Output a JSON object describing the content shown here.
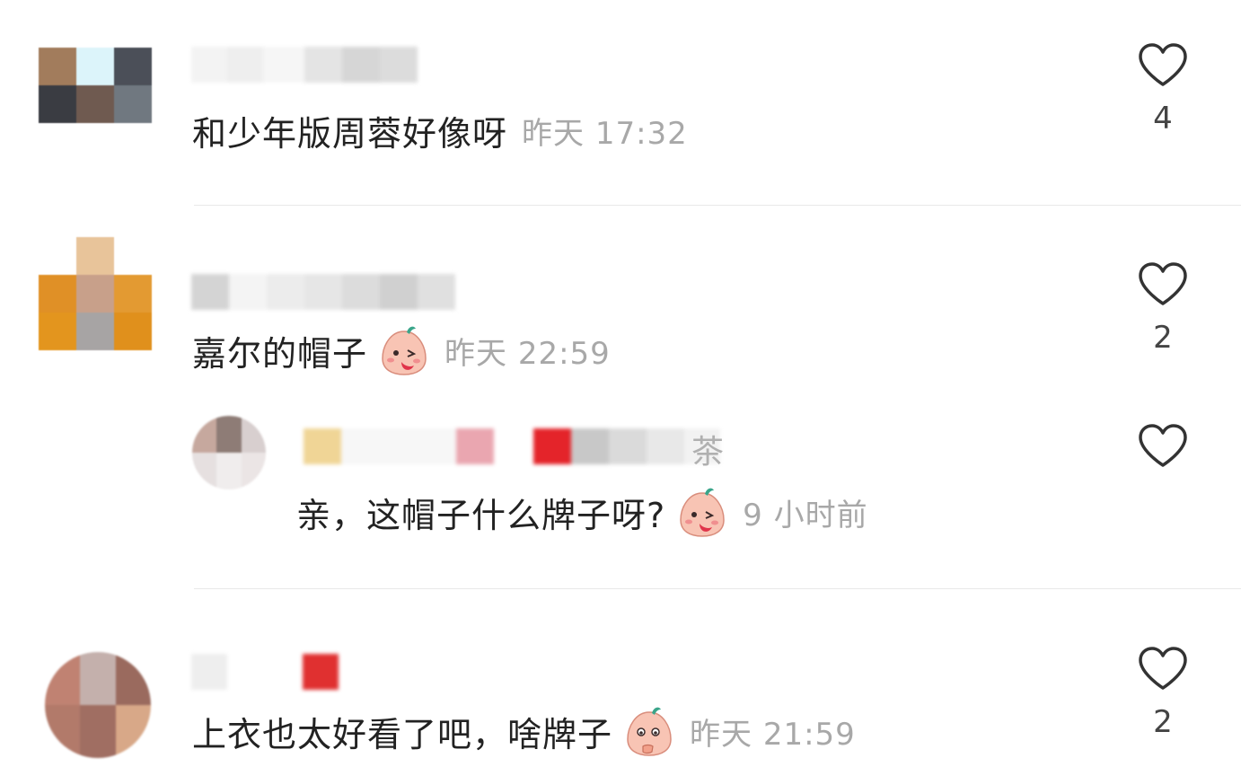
{
  "comments": [
    {
      "text": "和少年版周蓉好像呀",
      "time": "昨天 17:32",
      "likes": "4",
      "has_emoji": false
    },
    {
      "text": "嘉尔的帽子",
      "time": "昨天 22:59",
      "likes": "2",
      "has_emoji": true,
      "reply": {
        "name_tail": "茶",
        "text": "亲，这帽子什么牌子呀?",
        "time": "9 小时前",
        "has_emoji": true
      }
    },
    {
      "text": "上衣也太好看了吧，啥牌子",
      "time": "昨天 21:59",
      "likes": "2",
      "has_emoji": true
    }
  ],
  "icons": {
    "like": "heart-outline-icon",
    "emoji": "blushing-face-emoji-icon"
  },
  "colors": {
    "text": "#222222",
    "meta": "#a8a8a8",
    "heart_stroke": "#333333"
  }
}
